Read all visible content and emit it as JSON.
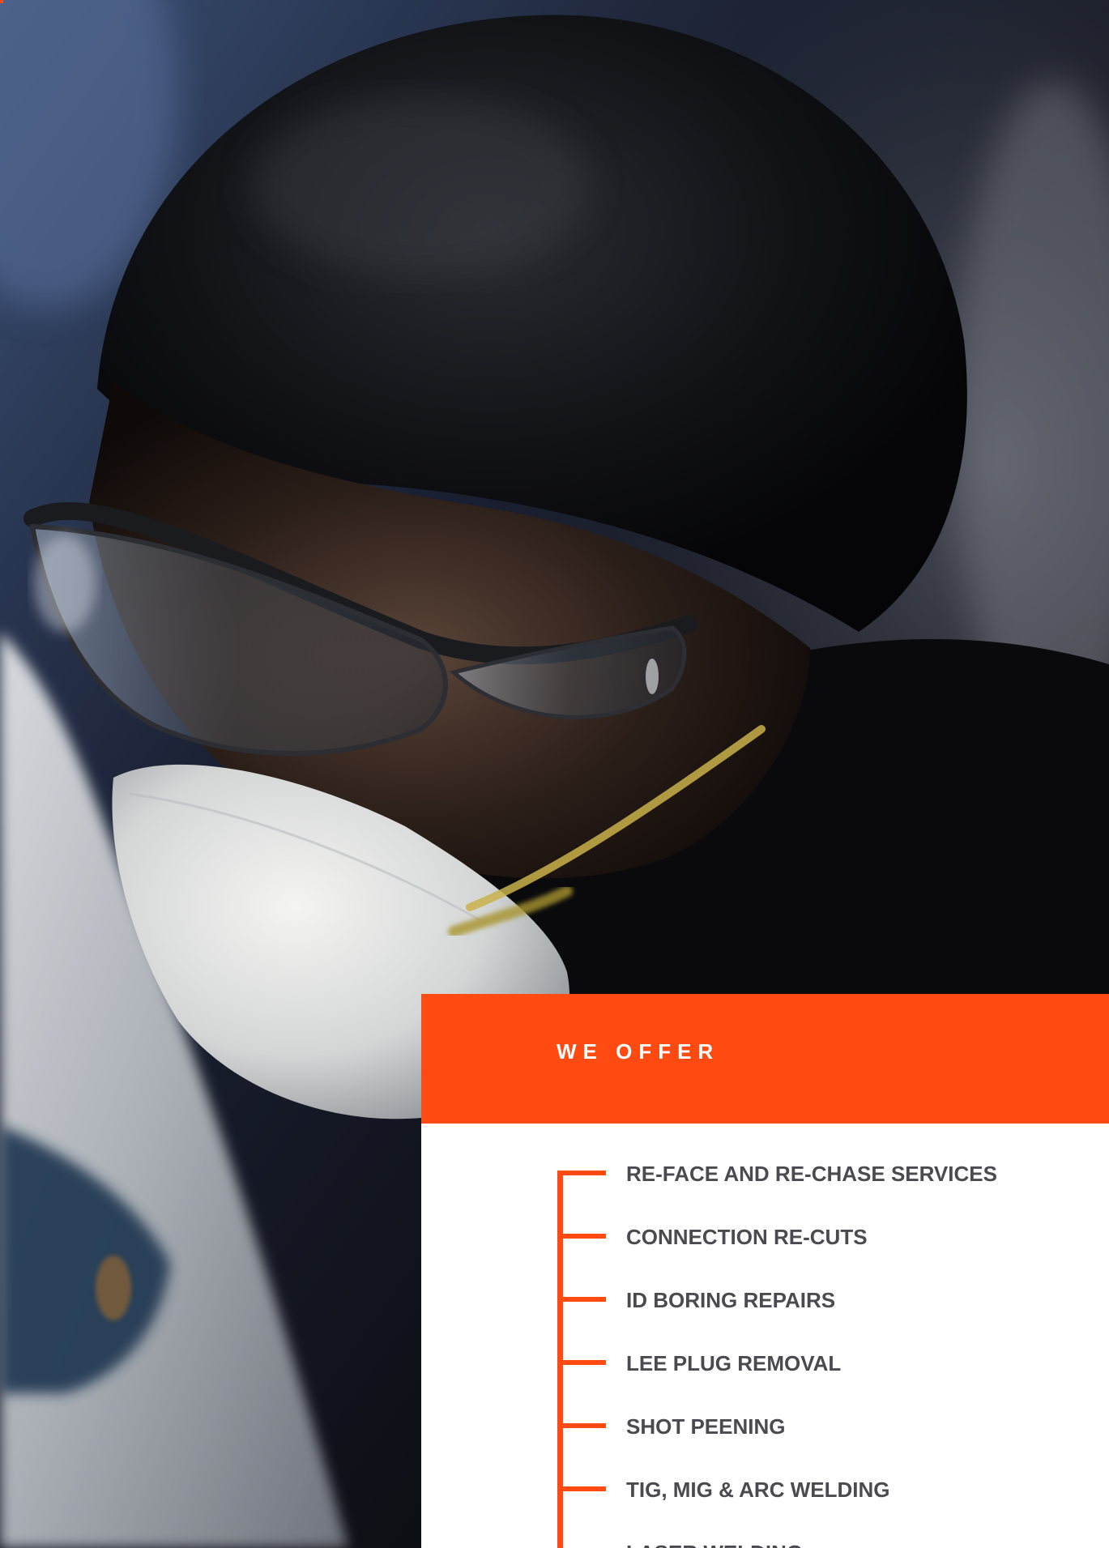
{
  "offer": {
    "title": "WE OFFER",
    "items": [
      "RE-FACE AND RE-CHASE SERVICES",
      "CONNECTION RE-CUTS",
      "ID BORING REPAIRS",
      "LEE PLUG REMOVAL",
      "SHOT PEENING",
      "TIG, MIG & ARC WELDING",
      "LASER WELDING"
    ]
  },
  "colors": {
    "accent": "#ff4a12",
    "text": "#4a4a50",
    "panel": "#ffffff"
  }
}
